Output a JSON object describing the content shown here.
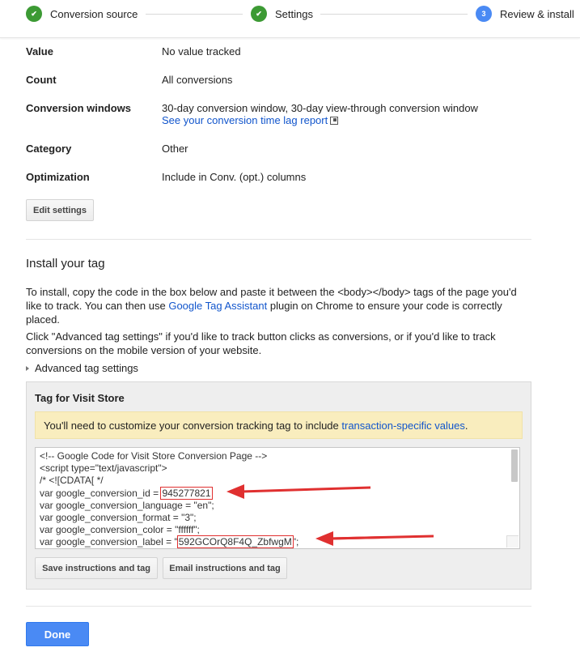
{
  "stepper": {
    "steps": [
      {
        "label": "Conversion source",
        "state": "done",
        "marker": "✔"
      },
      {
        "label": "Settings",
        "state": "done",
        "marker": "✔"
      },
      {
        "label": "Review & install",
        "state": "active",
        "marker": "3"
      }
    ]
  },
  "summary": {
    "rows": [
      {
        "key": "Value",
        "value": "No value tracked"
      },
      {
        "key": "Count",
        "value": "All conversions"
      },
      {
        "key": "Conversion windows",
        "value": "30-day conversion window, 30-day view-through conversion window",
        "link": "See your conversion time lag report"
      },
      {
        "key": "Category",
        "value": "Other"
      },
      {
        "key": "Optimization",
        "value": "Include in Conv. (opt.) columns"
      }
    ],
    "edit_button": "Edit settings"
  },
  "install": {
    "title": "Install your tag",
    "para1_before": "To install, copy the code in the box below and paste it between the <body></body> tags of the page you'd like to track. You can then use ",
    "para1_link": "Google Tag Assistant",
    "para1_after": " plugin on Chrome to ensure your code is correctly placed.",
    "para2": "Click \"Advanced tag settings\" if you'd like to track button clicks as conversions, or if you'd like to track conversions on the mobile version of your website.",
    "advanced_label": "Advanced tag settings"
  },
  "tag": {
    "title": "Tag for Visit Store",
    "notice_before": "You'll need to customize your conversion tracking tag to include ",
    "notice_link": "transaction-specific values",
    "notice_after": ".",
    "code_lines": [
      "<!-- Google Code for Visit Store Conversion Page -->",
      "<script type=\"text/javascript\">",
      "/* <![CDATA[ */"
    ],
    "conv_id_prefix": "var google_conversion_id = ",
    "conv_id_value": "945277821",
    "conv_lang": "var google_conversion_language = \"en\";",
    "conv_format": "var google_conversion_format = \"3\";",
    "conv_color": "var google_conversion_color = \"ffffff\";",
    "conv_label_prefix": "var google_conversion_label = \"",
    "conv_label_value": "592GCOrQ8F4Q_ZbfwgM",
    "conv_label_suffix": "\";",
    "save_button": "Save instructions and tag",
    "email_button": "Email instructions and tag"
  },
  "done_button": "Done",
  "colors": {
    "check_green": "#3c9a34",
    "active_blue": "#4a8af4",
    "link_blue": "#1155cc",
    "notice_bg": "#f9edbe",
    "highlight_red": "#e03030"
  }
}
